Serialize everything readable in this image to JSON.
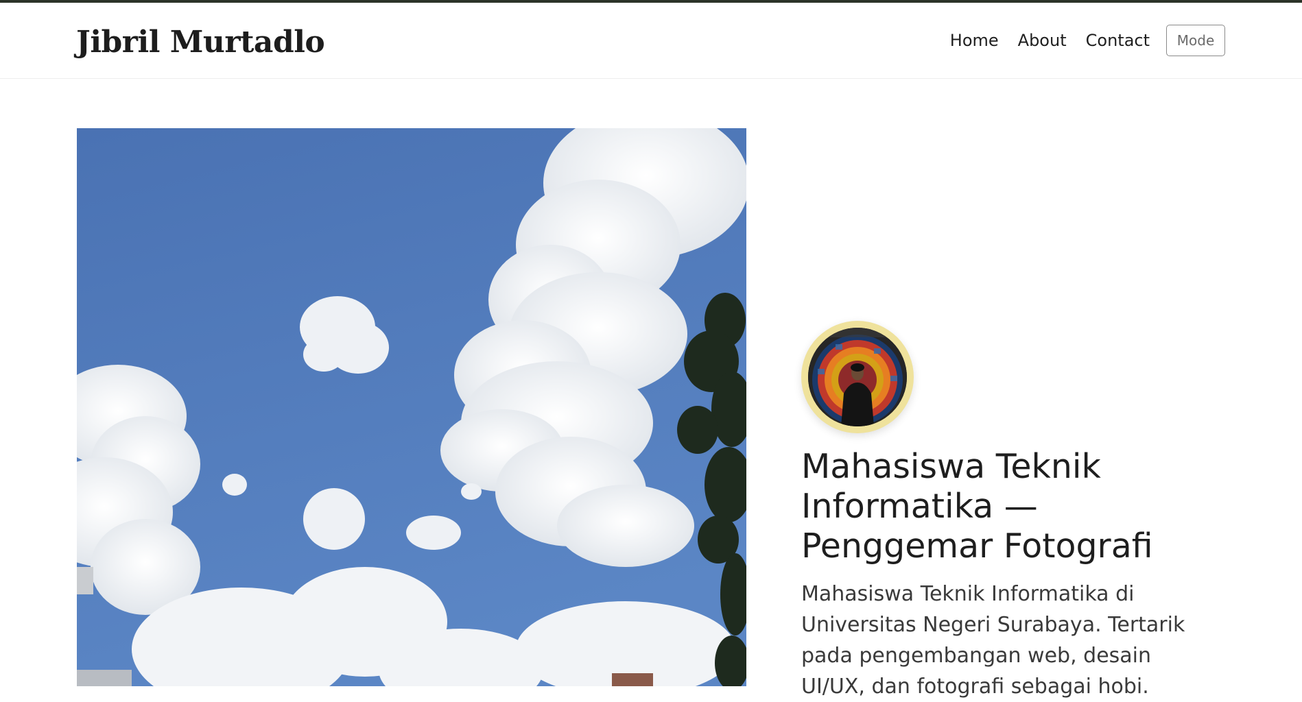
{
  "header": {
    "brand": "Jibril Murtadlo",
    "nav": [
      {
        "label": "Home"
      },
      {
        "label": "About"
      },
      {
        "label": "Contact"
      }
    ],
    "mode_label": "Mode"
  },
  "hero": {
    "headline": "Mahasiswa Teknik Informatika — Penggemar Fotografi",
    "intro": "Mahasiswa Teknik Informatika di Universitas Negeri Surabaya. Tertarik pada pengembangan web, desain UI/UX, dan fotografi sebagai hobi."
  },
  "colors": {
    "accent_ring": "#efe29c",
    "top_border": "#2b3328",
    "sky": "#4f79b8"
  },
  "images": {
    "hero_photo": "sky-clouds-tree-photo",
    "profile_photo": "person-portrait-mural"
  }
}
